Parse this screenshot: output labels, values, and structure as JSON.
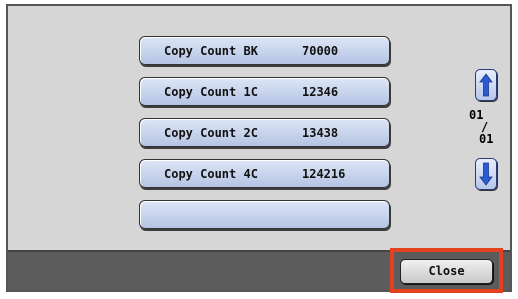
{
  "copy_counts": [
    {
      "label": "Copy Count BK",
      "value": "70000"
    },
    {
      "label": "Copy Count 1C",
      "value": "12346"
    },
    {
      "label": "Copy Count 2C",
      "value": "13438"
    },
    {
      "label": "Copy Count 4C",
      "value": "124216"
    },
    {
      "label": "",
      "value": ""
    }
  ],
  "pager": {
    "current": "01",
    "separator": "/",
    "total": "01",
    "up_icon": "up-arrow-icon",
    "down_icon": "down-arrow-icon"
  },
  "footer": {
    "close_label": "Close",
    "highlight_color": "#e3411f"
  }
}
